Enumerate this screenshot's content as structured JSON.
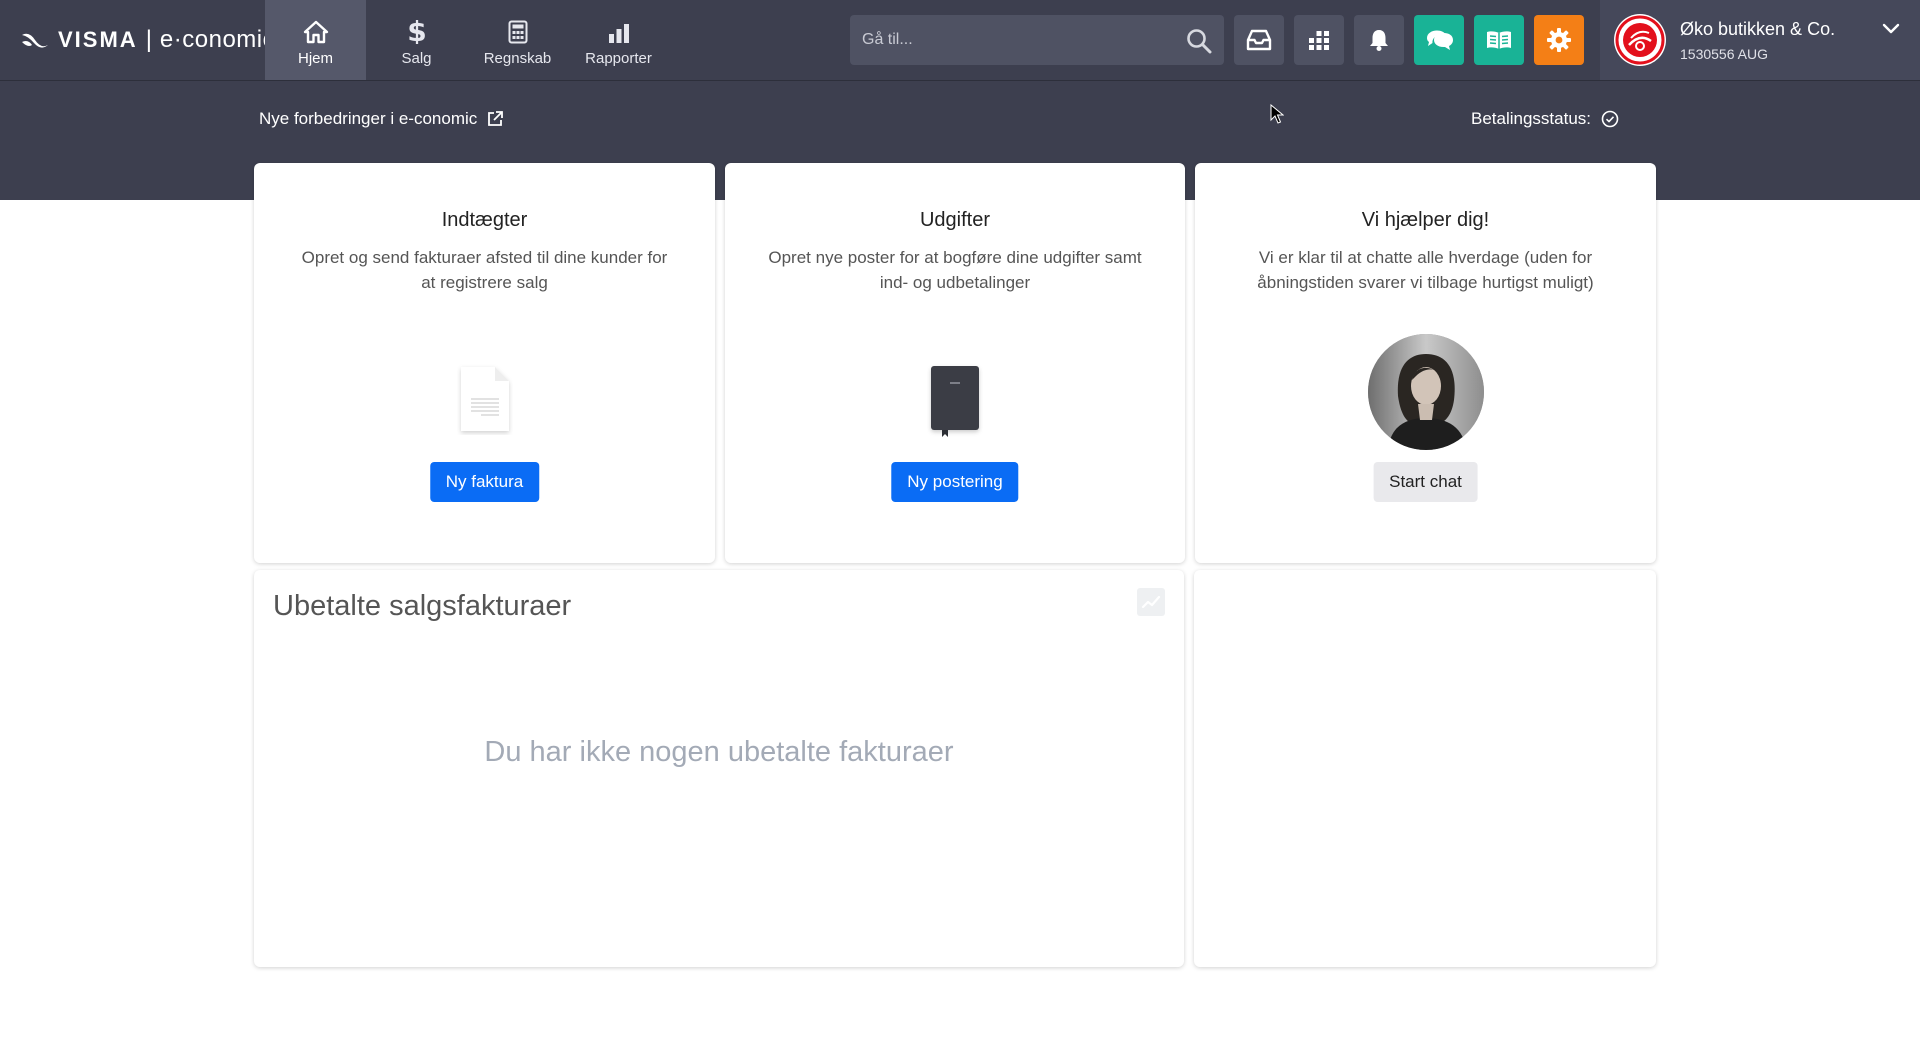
{
  "brand": {
    "logo_text": "VISMA",
    "separator": "|",
    "product": "e·conomic"
  },
  "nav": [
    {
      "label": "Hjem",
      "icon": "home-icon",
      "active": true
    },
    {
      "label": "Salg",
      "icon": "dollar-icon",
      "active": false
    },
    {
      "label": "Regnskab",
      "icon": "calculator-icon",
      "active": false
    },
    {
      "label": "Rapporter",
      "icon": "bar-chart-icon",
      "active": false
    }
  ],
  "search": {
    "placeholder": "Gå til...",
    "value": ""
  },
  "toolbar": {
    "inbox_icon": "inbox-icon",
    "apps_icon": "apps-grid-icon",
    "notifications_icon": "bell-icon",
    "chat_icon": "chat-bubbles-icon",
    "help_icon": "book-icon",
    "settings_icon": "gear-icon"
  },
  "account": {
    "name": "Øko butikken & Co.",
    "id": "1530556 AUG"
  },
  "subheader": {
    "news_link": "Nye forbedringer i e-conomic",
    "payment_status": "Betalingsstatus:"
  },
  "cards": {
    "income": {
      "title": "Indtægter",
      "description": "Opret og send fakturaer afsted til dine kunder for at registrere salg",
      "button": "Ny faktura"
    },
    "expenses": {
      "title": "Udgifter",
      "description": "Opret nye poster for at bogføre dine udgifter samt ind- og udbetalinger",
      "button": "Ny postering"
    },
    "help": {
      "title": "Vi hjælper dig!",
      "description": "Vi er klar til at chatte alle hverdage (uden for åbningstiden svarer vi tilbage hurtigst muligt)",
      "button": "Start chat"
    }
  },
  "unpaid": {
    "title": "Ubetalte salgsfakturaer",
    "empty_text": "Du har ikke nogen ubetalte fakturaer"
  },
  "colors": {
    "topbar": "#3d3f4f",
    "primary_button": "#0a6cf5",
    "green_button": "#19b396",
    "orange_button": "#f47f16"
  }
}
